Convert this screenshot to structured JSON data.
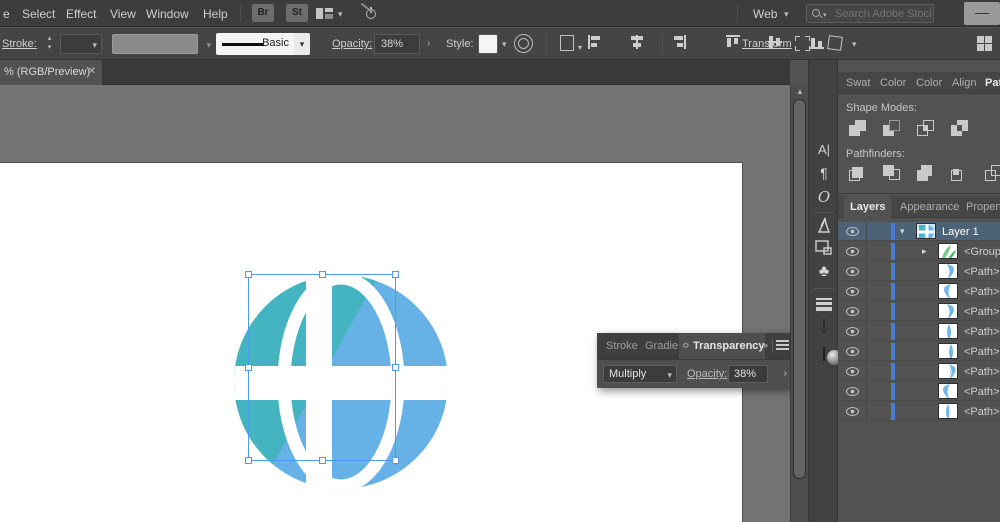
{
  "menu_bar": {
    "fragment": "e",
    "items": [
      "Select",
      "Effect",
      "View",
      "Window",
      "Help"
    ],
    "bridge_label": "Br",
    "stock_label": "St",
    "workspace": "Web",
    "search_placeholder": "Search Adobe Stock"
  },
  "control_bar": {
    "stroke_label": "Stroke:",
    "brush_name": "Basic",
    "opacity_label": "Opacity:",
    "opacity_value": "38%",
    "style_label": "Style:",
    "transform_label": "Transform"
  },
  "tab_bar": {
    "doc_tab_label": "% (RGB/Preview)",
    "close_glyph": "✕"
  },
  "transparency_panel": {
    "tab_stroke": "Stroke",
    "tab_gradient": "Gradie",
    "tab_transparency": "Transparency",
    "blend_mode": "Multiply",
    "opacity_label": "Opacity:",
    "opacity_value": "38%"
  },
  "pathfinder_panel": {
    "tabs": [
      "Swat",
      "Color",
      "Color",
      "Align",
      "Path"
    ],
    "shape_modes_label": "Shape Modes:",
    "pathfinders_label": "Pathfinders:"
  },
  "layers_panel": {
    "tab_layers": "Layers",
    "tab_appearance": "Appearance",
    "tab_properties": "Propertie",
    "rows": [
      {
        "label": "Layer 1"
      },
      {
        "label": "<Group>"
      },
      {
        "label": "<Path>"
      },
      {
        "label": "<Path>"
      },
      {
        "label": "<Path>"
      },
      {
        "label": "<Path>"
      },
      {
        "label": "<Path>"
      },
      {
        "label": "<Path>"
      },
      {
        "label": "<Path>"
      },
      {
        "label": "<Path>"
      }
    ]
  },
  "artwork": {
    "description": "globe logo",
    "globe_blue": "#66b1e6",
    "globe_teal": "#44b4c0",
    "selection_blue": "#4e9af0"
  }
}
